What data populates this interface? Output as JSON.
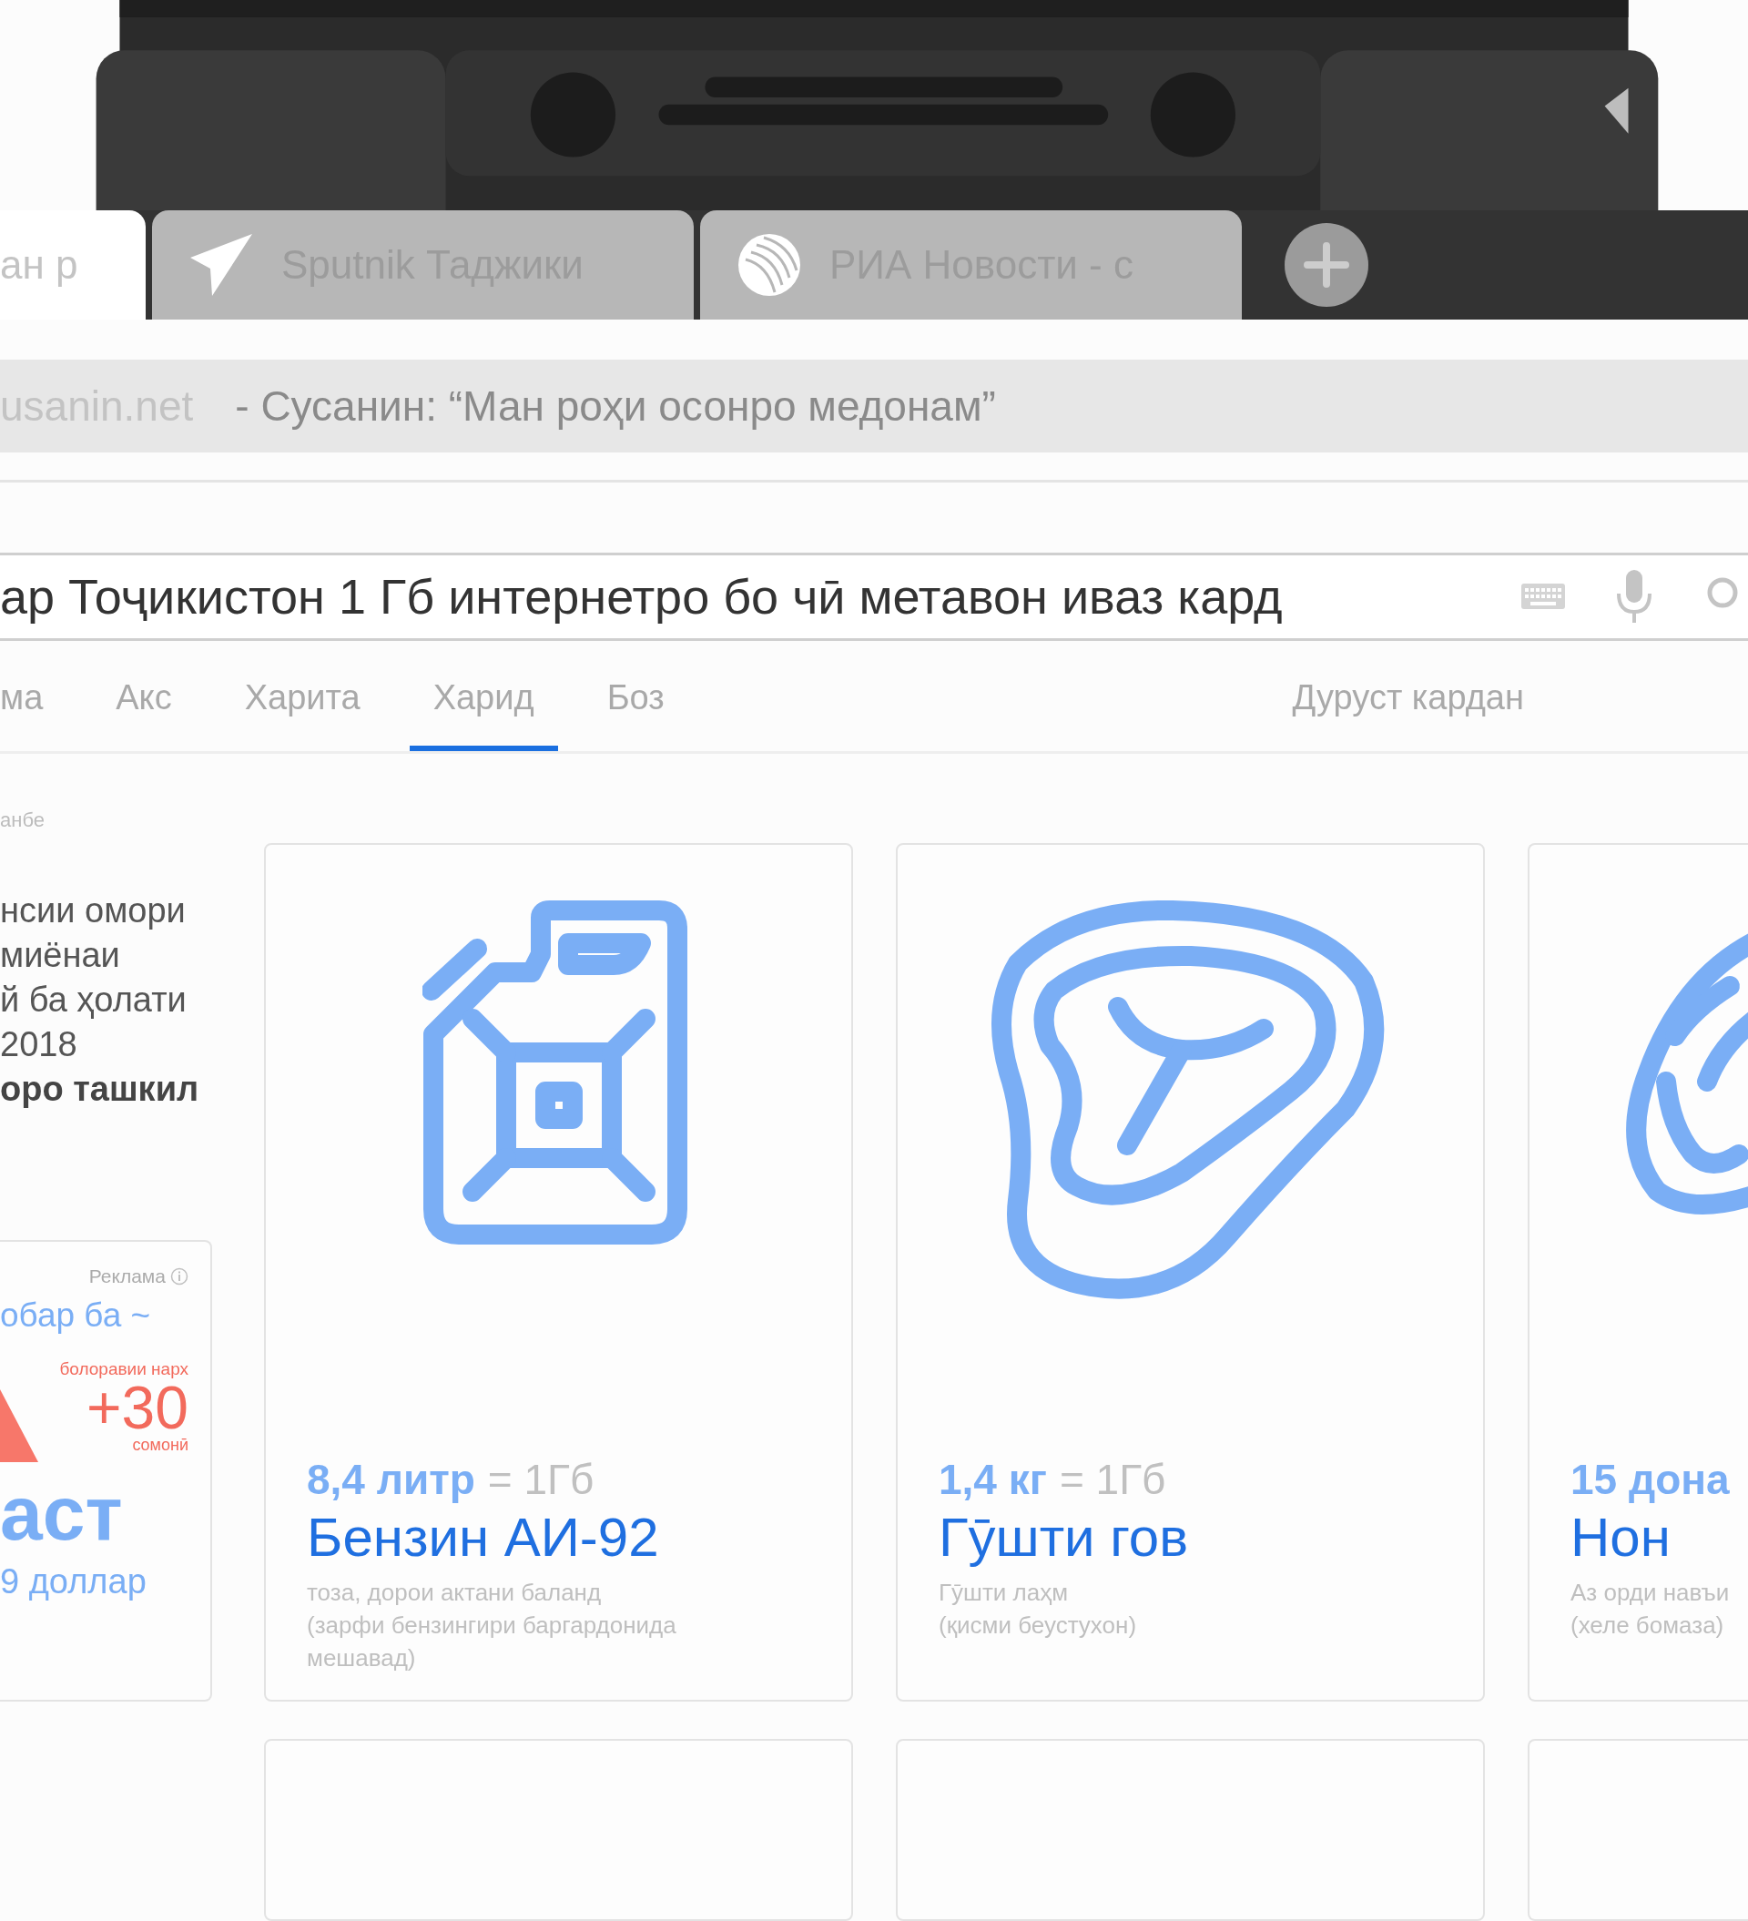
{
  "browser_tabs": [
    {
      "title": "ан р",
      "selected": true,
      "kind": "blank"
    },
    {
      "title": "Sputnik Таджики",
      "selected": false,
      "kind": "plane"
    },
    {
      "title": "РИА Новости - с",
      "selected": false,
      "kind": "globe"
    }
  ],
  "address_bar": {
    "domain": "usanin.net",
    "title": "- Сусанин: “Ман роҳи осонро медонам”"
  },
  "search": {
    "value": "ар Тоҷикистон 1 Гб интернетро бо чӣ метавон иваз кард"
  },
  "search_tabs": [
    {
      "label": "ма",
      "selected": false
    },
    {
      "label": "Акс",
      "selected": false
    },
    {
      "label": "Харита",
      "selected": false
    },
    {
      "label": "Харид",
      "selected": true
    },
    {
      "label": "Боз",
      "selected": false
    }
  ],
  "edit_link": "Дуруст кардан",
  "source_note": "анбе",
  "article": {
    "lines": [
      "нсии омори",
      "миёнаи",
      "й ба ҳолати",
      "2018",
      "**оро ташкил**"
    ]
  },
  "ad": {
    "label": "Реклама",
    "headline": "обар ба ~",
    "badge_caption": "болоравии нарх",
    "badge_value": "+30",
    "badge_unit": "сомонӣ",
    "big_text": "аст",
    "price": "9 доллар"
  },
  "products": [
    {
      "kind": "canister",
      "amount": "8,4 литр",
      "equals": "= 1Гб",
      "title": "Бензин АИ-92",
      "description": "тоза, дорои актани баланд\n(зарфи бензингири баргардонида\nмешавад)"
    },
    {
      "kind": "steak",
      "amount": "1,4 кг",
      "equals": "= 1Гб",
      "title": "Гӯшти гов",
      "description": "Гӯшти лаҳм\n(қисми беустухон)"
    },
    {
      "kind": "bread",
      "amount": "15 дона",
      "title": "Нон",
      "description": "Аз орди навъи\n(хеле бомаза)"
    }
  ]
}
